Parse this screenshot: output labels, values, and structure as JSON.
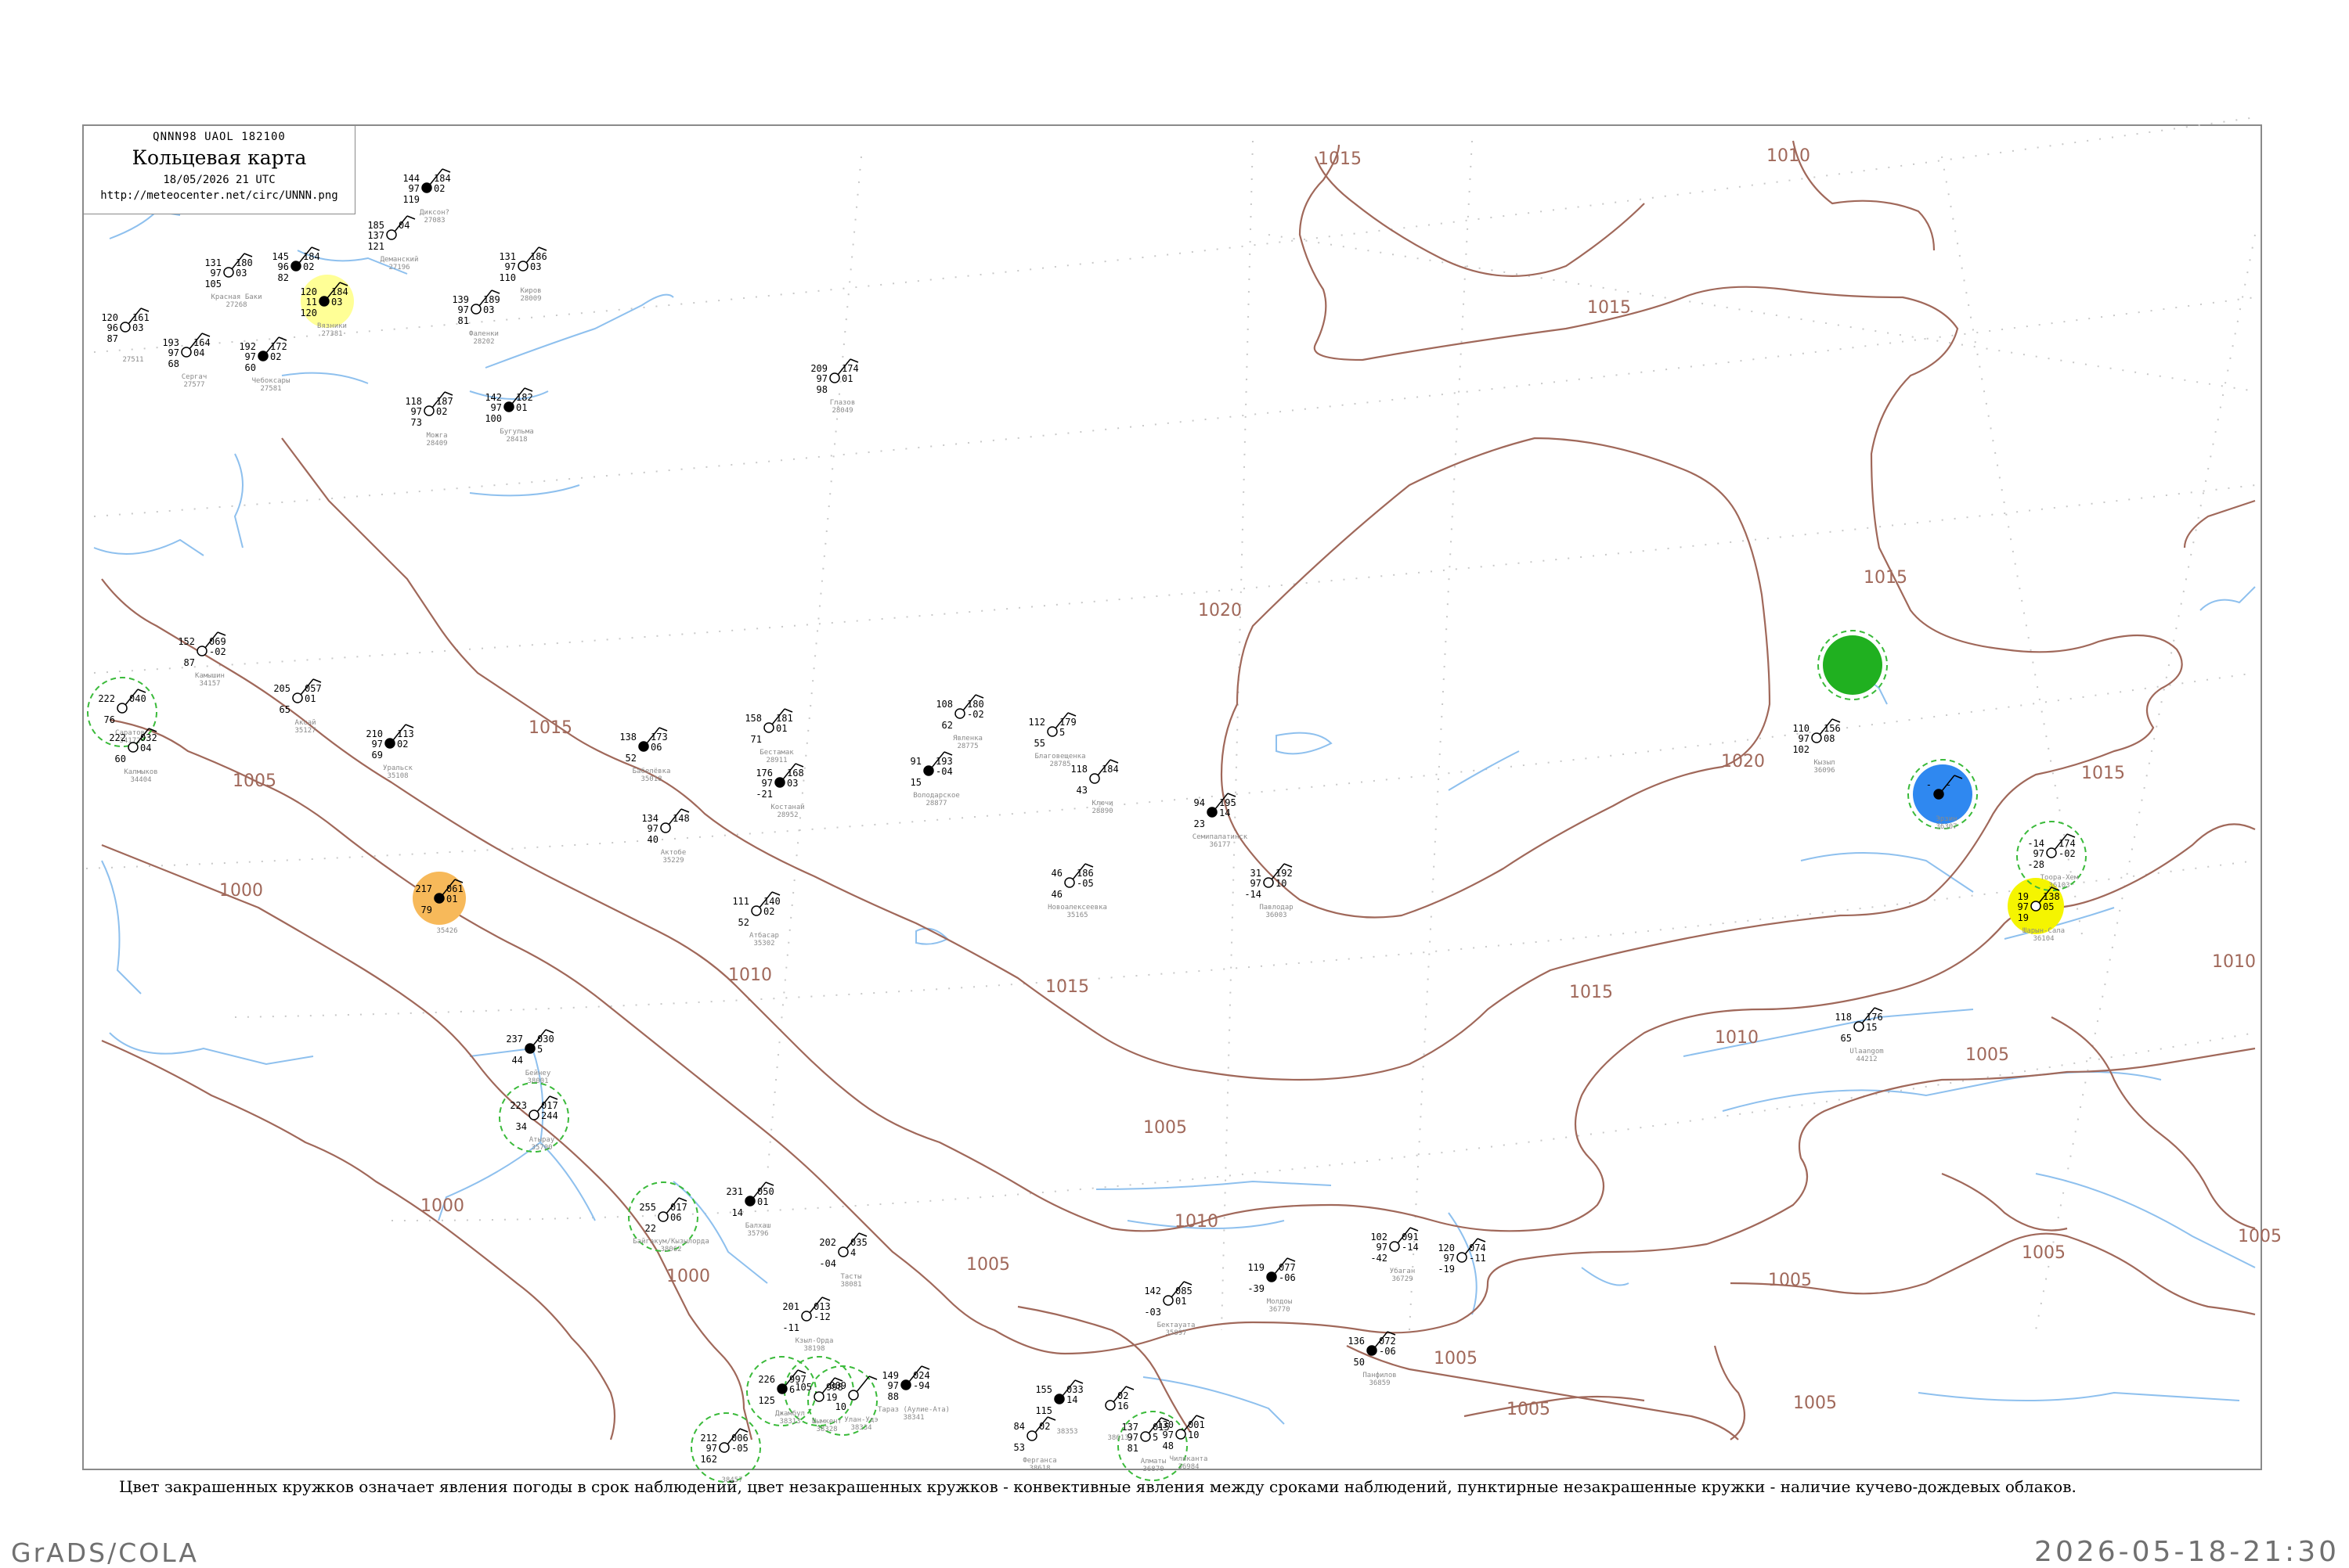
{
  "header": {
    "code": "QNNN98  UAOL  182100",
    "title": "Кольцевая карта",
    "datetime": "18/05/2026 21 UTC",
    "url": "http://meteocenter.net/circ/UNNN.png"
  },
  "caption": "Цвет закрашенных кружков означает явления погоды в срок наблюдений, цвет незакрашенных кружков - конвективные явления между сроками наблюдений, пунктирные незакрашенные кружки - наличие кучево-дождевых облаков.",
  "footer": {
    "software": "GrADS/COLA",
    "timestamp": "2026-05-18-21:30"
  },
  "colors": {
    "isobar": "#a0685a",
    "water": "#8ec0ee",
    "frame": "#8a8a8a",
    "cb_ring": "#3aba3a",
    "yellow_light": "#ffff96",
    "orange": "#f7b95a",
    "green": "#20b020",
    "blue": "#2f88f0",
    "yellow": "#f5f500"
  },
  "isobar_labels": [
    {
      "id": "i1",
      "text": "1015"
    },
    {
      "id": "i2",
      "text": "1010"
    },
    {
      "id": "i3",
      "text": "1015"
    },
    {
      "id": "i4",
      "text": "1020"
    },
    {
      "id": "i5",
      "text": "1015"
    },
    {
      "id": "i6",
      "text": "1020"
    },
    {
      "id": "i7",
      "text": "1015"
    },
    {
      "id": "i8",
      "text": "1015"
    },
    {
      "id": "i9",
      "text": "1005"
    },
    {
      "id": "i10",
      "text": "1000"
    },
    {
      "id": "i11",
      "text": "1010"
    },
    {
      "id": "i12",
      "text": "1015"
    },
    {
      "id": "i13",
      "text": "1015"
    },
    {
      "id": "i14",
      "text": "1010"
    },
    {
      "id": "i15",
      "text": "1010"
    },
    {
      "id": "i16",
      "text": "1005"
    },
    {
      "id": "i17",
      "text": "1000"
    },
    {
      "id": "i18",
      "text": "1000"
    },
    {
      "id": "i19",
      "text": "1010"
    },
    {
      "id": "i20",
      "text": "1005"
    },
    {
      "id": "i21",
      "text": "1005"
    },
    {
      "id": "i22",
      "text": "1005"
    },
    {
      "id": "i23",
      "text": "1005"
    },
    {
      "id": "i24",
      "text": "1005"
    },
    {
      "id": "i25",
      "text": "1005"
    },
    {
      "id": "i26",
      "text": "1005"
    },
    {
      "id": "i27",
      "text": "1005"
    }
  ],
  "stations": [
    {
      "id": "s1",
      "name": "Диксон?",
      "number": "27083",
      "T": "144",
      "P": "184",
      "Td": "97",
      "V": "119",
      "tr": "02"
    },
    {
      "id": "s2",
      "name": "Деманский",
      "number": "27196",
      "T": "185",
      "P": "04",
      "Td": "137",
      "V": "121",
      "tr": ""
    },
    {
      "id": "s3",
      "name": "Красная Баки",
      "number": "27268",
      "T": "131",
      "P": "180",
      "Td": "97",
      "V": "105",
      "tr": "03"
    },
    {
      "id": "s4",
      "name": "",
      "number": "",
      "T": "145",
      "P": "184",
      "Td": "96",
      "V": "82",
      "tr": "02"
    },
    {
      "id": "s5",
      "name": "Киров",
      "number": "28009",
      "T": "131",
      "P": "186",
      "Td": "97",
      "V": "110",
      "tr": "03"
    },
    {
      "id": "s6",
      "name": "Фаленки",
      "number": "28202",
      "T": "139",
      "P": "189",
      "Td": "97",
      "V": "81",
      "tr": "03"
    },
    {
      "id": "s7",
      "name": "Вязники",
      "number": "27381",
      "T": "120",
      "P": "184",
      "Td": "11",
      "V": "120",
      "tr": "03"
    },
    {
      "id": "s8",
      "name": "",
      "number": "27511",
      "T": "120",
      "P": "161",
      "Td": "96",
      "V": "87",
      "tr": "03"
    },
    {
      "id": "s9",
      "name": "Сергач",
      "number": "27577",
      "T": "193",
      "P": "164",
      "Td": "97",
      "V": "68",
      "tr": "04"
    },
    {
      "id": "s10",
      "name": "Чебоксары",
      "number": "27581",
      "T": "192",
      "P": "172",
      "Td": "97",
      "V": "60",
      "tr": "02"
    },
    {
      "id": "s11",
      "name": "Глазов",
      "number": "28049",
      "T": "209",
      "P": "174",
      "Td": "97",
      "V": "98",
      "tr": "01"
    },
    {
      "id": "s12",
      "name": "Можга",
      "number": "28409",
      "T": "118",
      "P": "187",
      "Td": "97",
      "V": "73",
      "tr": "02"
    },
    {
      "id": "s13",
      "name": "Бугульма",
      "number": "28418",
      "T": "142",
      "P": "182",
      "Td": "97",
      "V": "100",
      "tr": "01"
    },
    {
      "id": "s14",
      "name": "Камышин",
      "number": "34157",
      "T": "152",
      "P": "069",
      "Td": "",
      "V": "87",
      "tr": "-02"
    },
    {
      "id": "s15",
      "name": "Аксай",
      "number": "35127",
      "T": "205",
      "P": "057",
      "Td": "",
      "V": "65",
      "tr": "01"
    },
    {
      "id": "s16",
      "name": "Уральск",
      "number": "35108",
      "T": "210",
      "P": "113",
      "Td": "97",
      "V": "69",
      "tr": "02"
    },
    {
      "id": "s17",
      "name": "Саратов",
      "number": "34172",
      "T": "222",
      "P": "040",
      "Td": "",
      "V": "76",
      "tr": ""
    },
    {
      "id": "s18",
      "name": "Калмыков",
      "number": "34404",
      "T": "222",
      "P": "032",
      "Td": "",
      "V": "60",
      "tr": "04"
    },
    {
      "id": "s19",
      "name": "Бабелёвка",
      "number": "35018",
      "T": "138",
      "P": "173",
      "Td": "",
      "V": "52",
      "tr": "06"
    },
    {
      "id": "s20",
      "name": "Актобе",
      "number": "35229",
      "T": "134",
      "P": "148",
      "Td": "97",
      "V": "40",
      "tr": ""
    },
    {
      "id": "s21",
      "name": "Бестамак",
      "number": "28911",
      "T": "158",
      "P": "181",
      "Td": "",
      "V": "71",
      "tr": "01"
    },
    {
      "id": "s22",
      "name": "Костанай",
      "number": "28952",
      "T": "176",
      "P": "168",
      "Td": "97",
      "V": "-21",
      "tr": "03"
    },
    {
      "id": "s23",
      "name": "Атбасар",
      "number": "35302",
      "T": "111",
      "P": "140",
      "Td": "",
      "V": "52",
      "tr": "02"
    },
    {
      "id": "s24",
      "name": "Явленка",
      "number": "28775",
      "T": "108",
      "P": "180",
      "Td": "",
      "V": "62",
      "tr": "-02"
    },
    {
      "id": "s25",
      "name": "Володарское",
      "number": "28877",
      "T": "91",
      "P": "193",
      "Td": "",
      "V": "15",
      "tr": "-04"
    },
    {
      "id": "s26",
      "name": "Благовещенка",
      "number": "28785",
      "T": "112",
      "P": "179",
      "Td": "",
      "V": "55",
      "tr": "5"
    },
    {
      "id": "s27",
      "name": "Ключи",
      "number": "28890",
      "T": "118",
      "P": "184",
      "Td": "",
      "V": "43",
      "tr": ""
    },
    {
      "id": "s28",
      "name": "Семипалатинск",
      "number": "36177",
      "T": "94",
      "P": "195",
      "Td": "",
      "V": "23",
      "tr": "14"
    },
    {
      "id": "s29",
      "name": "Павлодар",
      "number": "36003",
      "T": "31",
      "P": "192",
      "Td": "97",
      "V": "-14",
      "tr": "10"
    },
    {
      "id": "s30",
      "name": "Новоалексеевка",
      "number": "35165",
      "T": "46",
      "P": "186",
      "Td": "",
      "V": "46",
      "tr": "-05"
    },
    {
      "id": "s31",
      "name": "",
      "number": "35426",
      "T": "217",
      "P": "061",
      "Td": "",
      "V": "79",
      "tr": "01"
    },
    {
      "id": "s32",
      "name": "Кызыл",
      "number": "36096",
      "T": "110",
      "P": "156",
      "Td": "97",
      "V": "102",
      "tr": "08"
    },
    {
      "id": "s33",
      "name": "Тоора-Хем",
      "number": "36103",
      "T": "-14",
      "P": "174",
      "Td": "97",
      "V": "-28",
      "tr": "-02"
    },
    {
      "id": "s34",
      "name": "Эрзин",
      "number": "36307",
      "T": "-",
      "P": "-",
      "Td": "",
      "V": "",
      "tr": ""
    },
    {
      "id": "s35",
      "name": "Шарын-Сала",
      "number": "36104",
      "T": "19",
      "P": "138",
      "Td": "97",
      "V": "19",
      "tr": "05"
    },
    {
      "id": "s36",
      "name": "Ulaangom",
      "number": "44212",
      "T": "118",
      "P": "176",
      "Td": "",
      "V": "65",
      "tr": "15"
    },
    {
      "id": "s37",
      "name": "Бейнеу",
      "number": "38001",
      "T": "237",
      "P": "030",
      "Td": "",
      "V": "44",
      "tr": "5"
    },
    {
      "id": "s38",
      "name": "Атырау",
      "number": "35700",
      "T": "223",
      "P": "017",
      "Td": "",
      "V": "34",
      "tr": "244"
    },
    {
      "id": "s39",
      "name": "Байгакум/Кызылорда",
      "number": "38062",
      "T": "255",
      "P": "017",
      "Td": "",
      "V": "22",
      "tr": "06"
    },
    {
      "id": "s40",
      "name": "Балхаш",
      "number": "35796",
      "T": "231",
      "P": "050",
      "Td": "",
      "V": "14",
      "tr": "01"
    },
    {
      "id": "s41",
      "name": "Тасты",
      "number": "38081",
      "T": "202",
      "P": "035",
      "Td": "",
      "V": "-04",
      "tr": "4"
    },
    {
      "id": "s42",
      "name": "Кзыл-Орда",
      "number": "38198",
      "T": "201",
      "P": "013",
      "Td": "",
      "V": "-11",
      "tr": "-12"
    },
    {
      "id": "s43",
      "name": "Джамбул",
      "number": "38313",
      "T": "226",
      "P": "997",
      "Td": "",
      "V": "125",
      "tr": "6"
    },
    {
      "id": "s44",
      "name": "Шымкент",
      "number": "38328",
      "T": "105",
      "P": "998",
      "Td": "",
      "V": "",
      "tr": "19"
    },
    {
      "id": "s45",
      "name": "Улан-Удэ",
      "number": "38334",
      "T": "009",
      "P": "",
      "Td": "",
      "V": "10",
      "tr": ""
    },
    {
      "id": "s46",
      "name": "Тараз (Аулие-Ата)",
      "number": "38341",
      "T": "149",
      "P": "024",
      "Td": "97",
      "V": "88",
      "tr": "-94"
    },
    {
      "id": "s47",
      "name": "",
      "number": "38457",
      "T": "212",
      "P": "006",
      "Td": "97",
      "V": "162",
      "tr": "-05"
    },
    {
      "id": "s48",
      "name": "Бектауата",
      "number": "35897",
      "T": "142",
      "P": "085",
      "Td": "",
      "V": "-03",
      "tr": "01"
    },
    {
      "id": "s49",
      "name": "Молдоы",
      "number": "36770",
      "T": "119",
      "P": "077",
      "Td": "",
      "V": "-39",
      "tr": "-06"
    },
    {
      "id": "s50",
      "name": "Убаган",
      "number": "36729",
      "T": "102",
      "P": "091",
      "Td": "97",
      "V": "-42",
      "tr": "-14"
    },
    {
      "id": "s51",
      "name": "",
      "number": "",
      "T": "120",
      "P": "074",
      "Td": "97",
      "V": "-19",
      "tr": "-11"
    },
    {
      "id": "s52",
      "name": "Панфилов",
      "number": "36859",
      "T": "136",
      "P": "072",
      "Td": "",
      "V": "50",
      "tr": "-06"
    },
    {
      "id": "s53",
      "name": "Алматы",
      "number": "36870",
      "T": "137",
      "P": "015",
      "Td": "97",
      "V": "81",
      "tr": "5"
    },
    {
      "id": "s54",
      "name": "Чиликанта",
      "number": "36984",
      "T": "130",
      "P": "001",
      "Td": "97",
      "V": "48",
      "tr": "10"
    },
    {
      "id": "s55",
      "name": "",
      "number": "38353",
      "T": "155",
      "P": "033",
      "Td": "",
      "V": "115",
      "tr": "14"
    },
    {
      "id": "s56",
      "name": "Ферганса",
      "number": "38618",
      "T": "84",
      "P": "02",
      "Td": "",
      "V": "53",
      "tr": ""
    },
    {
      "id": "s57",
      "name": "",
      "number": "38613",
      "T": "",
      "P": "02",
      "Td": "",
      "V": "",
      "tr": "16"
    }
  ],
  "features": {
    "coastlines_shown": true,
    "rivers_shown": true,
    "isobars_shown": true,
    "station_plots": "synop"
  }
}
